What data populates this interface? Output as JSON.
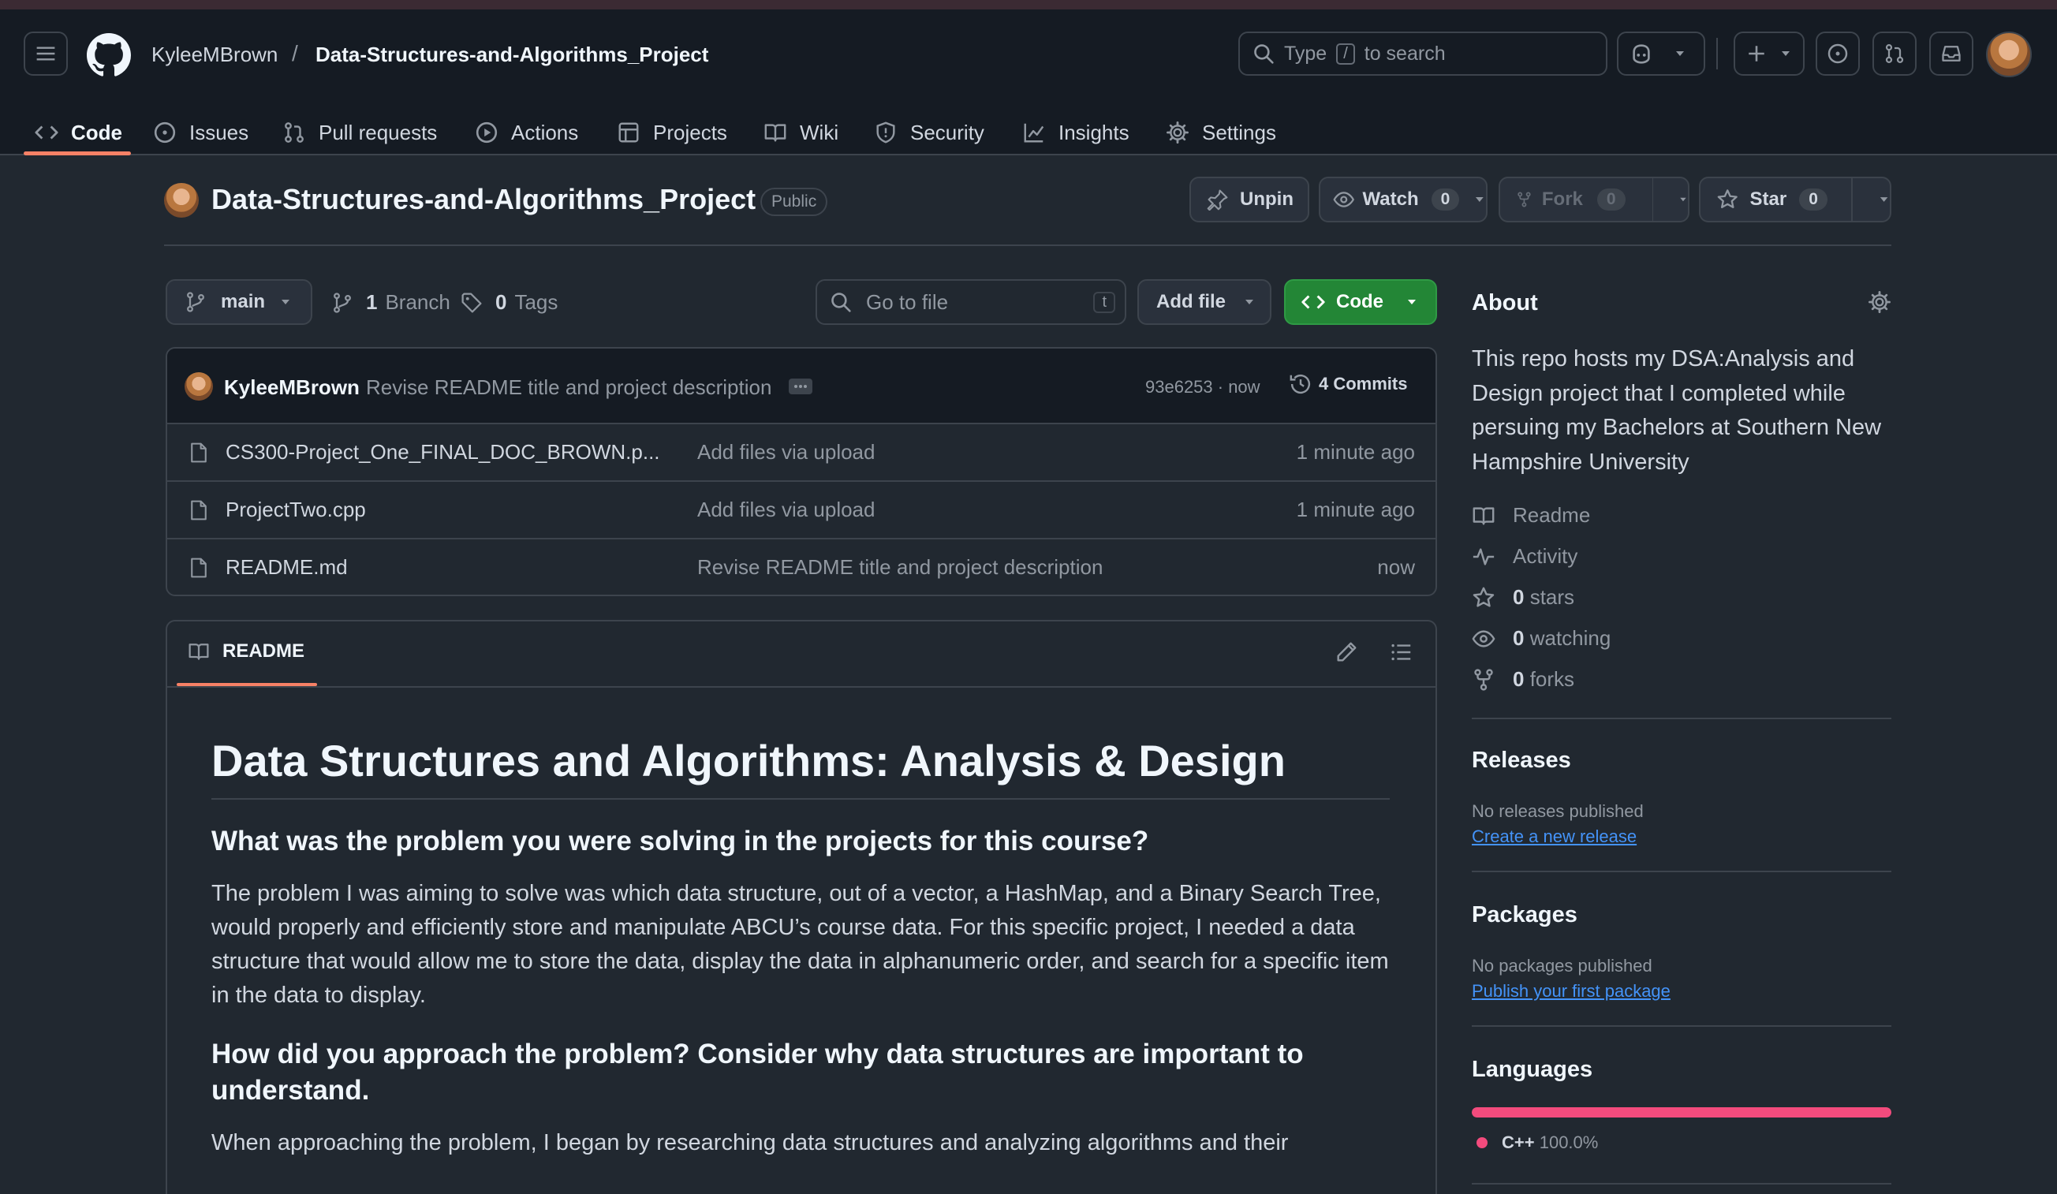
{
  "header": {
    "owner": "KyleeMBrown",
    "separator": "/",
    "repo": "Data-Structures-and-Algorithms_Project",
    "search_prefix": "Type",
    "search_key": "/",
    "search_suffix": "to search"
  },
  "tabs": [
    {
      "label": "Code",
      "icon": "code-icon",
      "active": true
    },
    {
      "label": "Issues",
      "icon": "issue-icon"
    },
    {
      "label": "Pull requests",
      "icon": "pull-request-icon"
    },
    {
      "label": "Actions",
      "icon": "play-icon"
    },
    {
      "label": "Projects",
      "icon": "table-icon"
    },
    {
      "label": "Wiki",
      "icon": "book-icon"
    },
    {
      "label": "Security",
      "icon": "shield-icon"
    },
    {
      "label": "Insights",
      "icon": "graph-icon"
    },
    {
      "label": "Settings",
      "icon": "gear-icon"
    }
  ],
  "repo_header": {
    "title": "Data-Structures-and-Algorithms_Project",
    "visibility": "Public",
    "unpin": "Unpin",
    "watch": "Watch",
    "watch_count": "0",
    "fork": "Fork",
    "fork_count": "0",
    "star": "Star",
    "star_count": "0"
  },
  "toolbar": {
    "branch": "main",
    "branches_count": "1",
    "branches_label": "Branch",
    "tags_count": "0",
    "tags_label": "Tags",
    "goto_placeholder": "Go to file",
    "goto_key": "t",
    "add_file": "Add file",
    "code": "Code"
  },
  "commit": {
    "author": "KyleeMBrown",
    "message": "Revise README title and project description",
    "hash": "93e6253 · now",
    "commits": "4 Commits"
  },
  "files": [
    {
      "name": "CS300-Project_One_FINAL_DOC_BROWN.p...",
      "message": "Add files via upload",
      "time": "1 minute ago"
    },
    {
      "name": "ProjectTwo.cpp",
      "message": "Add files via upload",
      "time": "1 minute ago"
    },
    {
      "name": "README.md",
      "message": "Revise README title and project description",
      "time": "now"
    }
  ],
  "readme": {
    "tab": "README",
    "h1": "Data Structures and Algorithms: Analysis & Design",
    "h2a": "What was the problem you were solving in the projects for this course?",
    "p1": "The problem I was aiming to solve was which data structure, out of a vector, a HashMap, and a Binary Search Tree, would properly and efficiently store and manipulate ABCU’s course data. For this specific project, I needed a data structure that would allow me to store the data, display the data in alphanumeric order, and search for a specific item in the data to display.",
    "h2b": "How did you approach the problem? Consider why data structures are important to understand.",
    "p2": "When approaching the problem, I began by researching data structures and analyzing algorithms and their"
  },
  "about": {
    "title": "About",
    "description": "This repo hosts my DSA:Analysis and Design project that I completed while persuing my Bachelors at Southern New Hampshire University",
    "readme": "Readme",
    "activity": "Activity",
    "stars_count": "0",
    "stars": "stars",
    "watching_count": "0",
    "watching": "watching",
    "forks_count": "0",
    "forks": "forks"
  },
  "releases": {
    "title": "Releases",
    "none": "No releases published",
    "link": "Create a new release"
  },
  "packages": {
    "title": "Packages",
    "none": "No packages published",
    "link": "Publish your first package"
  },
  "languages": {
    "title": "Languages",
    "items": [
      {
        "name": "C++",
        "percent": "100.0%",
        "share": 1.0,
        "color": "#f34b7d"
      }
    ]
  },
  "colors": {
    "accent_green": "#238636",
    "tab_underline": "#f78166",
    "link": "#4493f8"
  }
}
